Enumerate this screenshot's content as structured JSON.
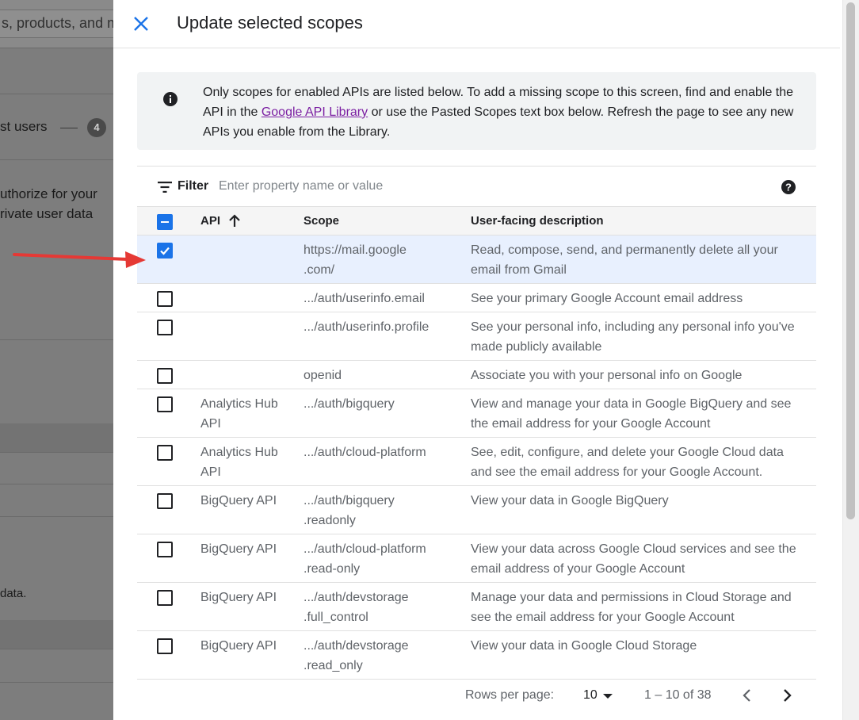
{
  "background": {
    "search_text": "s, products, and m",
    "step_label": "st users",
    "step_number": "4",
    "paragraph_line1": "uthorize for your",
    "paragraph_line2": "rivate user data",
    "data_text": "data."
  },
  "dialog": {
    "title": "Update selected scopes",
    "info": {
      "text_before": "Only scopes for enabled APIs are listed below. To add a missing scope to this screen, find and enable the API in the ",
      "link_text": "Google API Library",
      "text_after": " or use the Pasted Scopes text box below. Refresh the page to see any new APIs you enable from the Library."
    },
    "filter": {
      "label": "Filter",
      "placeholder": "Enter property name or value"
    },
    "columns": {
      "api": "API",
      "scope": "Scope",
      "description": "User-facing description"
    },
    "rows": [
      {
        "checked": true,
        "api": "",
        "scope": "https://mail.google\n.com/",
        "description": "Read, compose, send, and permanently delete all your email from Gmail",
        "height": 61
      },
      {
        "checked": false,
        "api": "",
        "scope": ".../auth/userinfo.email",
        "description": "See your primary Google Account email address",
        "height": 36
      },
      {
        "checked": false,
        "api": "",
        "scope": ".../auth/userinfo.profile",
        "description": "See your personal info, including any personal info you've made publicly available",
        "height": 61
      },
      {
        "checked": false,
        "api": "",
        "scope": "openid",
        "description": "Associate you with your personal info on Google",
        "height": 36
      },
      {
        "checked": false,
        "api": "Analytics Hub API",
        "scope": ".../auth/bigquery",
        "description": "View and manage your data in Google BigQuery and see the email address for your Google Account",
        "height": 61
      },
      {
        "checked": false,
        "api": "Analytics Hub API",
        "scope": ".../auth/cloud-platform",
        "description": "See, edit, configure, and delete your Google Cloud data and see the email address for your Google Account.",
        "height": 61
      },
      {
        "checked": false,
        "api": "BigQuery API",
        "scope": ".../auth/bigquery\n.readonly",
        "description": "View your data in Google BigQuery",
        "height": 61
      },
      {
        "checked": false,
        "api": "BigQuery API",
        "scope": ".../auth/cloud-platform\n.read-only",
        "description": "View your data across Google Cloud services and see the email address of your Google Account",
        "height": 61
      },
      {
        "checked": false,
        "api": "BigQuery API",
        "scope": ".../auth/devstorage\n.full_control",
        "description": "Manage your data and permissions in Cloud Storage and see the email address for your Google Account",
        "height": 61
      },
      {
        "checked": false,
        "api": "BigQuery API",
        "scope": ".../auth/devstorage\n.read_only",
        "description": "View your data in Google Cloud Storage",
        "height": 61
      }
    ],
    "pagination": {
      "rows_per_page_label": "Rows per page:",
      "rows_per_page_value": "10",
      "range_text": "1 – 10 of 38"
    },
    "colors": {
      "accent": "#1a73e8",
      "link": "#7b1fa2",
      "selected_row": "#e8f0fe",
      "annotation_arrow": "#e53935"
    },
    "icons": {
      "close": "close-icon",
      "info": "info-icon",
      "filter": "filter-icon",
      "help": "help-icon",
      "sort": "arrow-up-icon",
      "prev": "chevron-left-icon",
      "next": "chevron-right-icon"
    }
  }
}
